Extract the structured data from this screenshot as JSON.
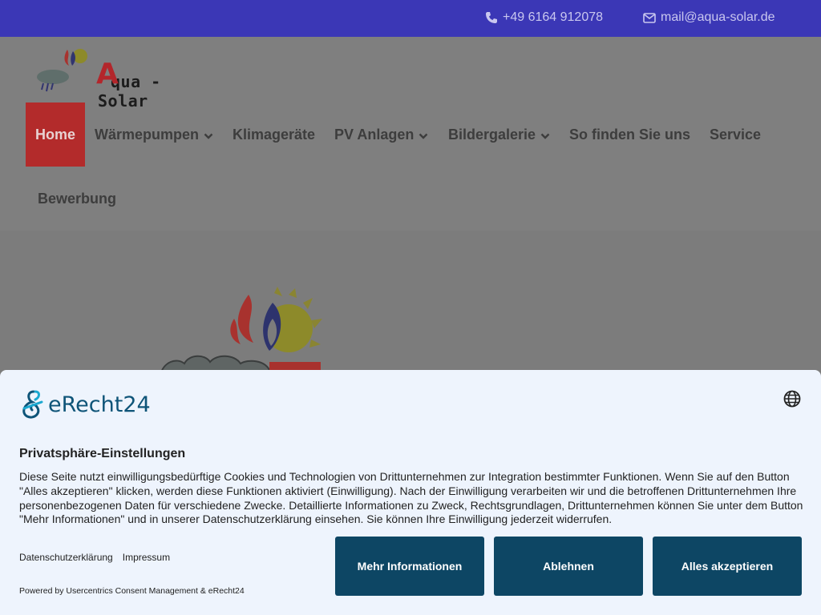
{
  "topbar": {
    "phone": "+49 6164 912078",
    "email": "mail@aqua-solar.de",
    "phone_icon": "phone-icon",
    "email_icon": "envelope-icon"
  },
  "logo": {
    "text_a": "A",
    "text_rest": "qua - Solar"
  },
  "nav": {
    "items": [
      {
        "label": "Home",
        "active": true
      },
      {
        "label": "Wärmepumpen",
        "dropdown": true
      },
      {
        "label": "Klimageräte"
      },
      {
        "label": "PV Anlagen",
        "dropdown": true
      },
      {
        "label": "Bildergalerie",
        "dropdown": true
      },
      {
        "label": "So finden Sie uns"
      },
      {
        "label": "Service"
      },
      {
        "label": "Bewerbung"
      }
    ]
  },
  "consent": {
    "brand": "eRecht24",
    "title": "Privatsphäre-Einstellungen",
    "description": "Diese Seite nutzt einwilligungsbedürftige Cookies und Technologien von Drittunternehmen zur Integration bestimmter Funktionen. Wenn Sie auf den Button \"Alles akzeptieren\" klicken, werden diese Funktionen aktiviert (Einwilligung). Nach der Einwilligung verarbeiten wir und die betroffenen Drittunternehmen Ihre personenbezogenen Daten für verschiedene Zwecke. Detaillierte Informationen zu Zweck, Rechtsgrundlagen, Drittunternehmen können Sie unter dem Button \"Mehr Informationen\" und in unserer Datenschutzerklärung einsehen. Sie können Ihre Einwilligung jederzeit widerrufen.",
    "link_privacy": "Datenschutzerklärung",
    "link_imprint": "Impressum",
    "powered": "Powered by Usercentrics Consent Management & eRecht24",
    "btn_more": "Mehr Informationen",
    "btn_deny": "Ablehnen",
    "btn_accept": "Alles akzeptieren",
    "language_icon": "globe-icon"
  },
  "colors": {
    "topbar": "#3b37b6",
    "active_nav": "#b32b2b",
    "button": "#0d4664",
    "banner_bg": "#eef4fd"
  }
}
